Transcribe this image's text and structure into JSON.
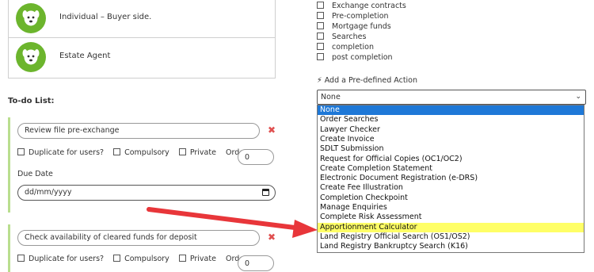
{
  "contacts": [
    {
      "name": "Individual – Buyer side."
    },
    {
      "name": "Estate Agent"
    }
  ],
  "todo": {
    "title": "To-do List:",
    "tasks": [
      {
        "text": "Review file pre-exchange",
        "order": "0"
      },
      {
        "text": "Check availability of cleared funds for deposit",
        "order": "0"
      }
    ],
    "options": {
      "duplicate": "Duplicate for users?",
      "compulsory": "Compulsory",
      "private": "Private",
      "order": "Order:"
    },
    "due_date_label": "Due Date",
    "date_placeholder": "dd/mm/yyyy",
    "remove_glyph": "✖"
  },
  "stages": [
    "Exchange contracts",
    "Pre-completion",
    "Mortgage funds",
    "Searches",
    "completion",
    "post completion"
  ],
  "action": {
    "label": "Add a Pre-defined Action",
    "label_icon": "⚡",
    "selected": "None",
    "caret": "⌄",
    "options": [
      "None",
      "Order Searches",
      "Lawyer Checker",
      "Create Invoice",
      "SDLT Submission",
      "Request for Official Copies (OC1/OC2)",
      "Create Completion Statement",
      "Electronic Document Registration (e-DRS)",
      "Create Fee Illustration",
      "Completion Checkpoint",
      "Manage Enquiries",
      "Complete Risk Assessment",
      "Apportionment Calculator",
      "Land Registry Official Search (OS1/OS2)",
      "Land Registry Bankruptcy Search (K16)"
    ]
  },
  "colors": {
    "avatar": "#6cb52d",
    "task_border": "#b9de8f",
    "selected_option": "#1e78d7",
    "highlight": "#ffff66",
    "arrow": "#e8363a"
  }
}
